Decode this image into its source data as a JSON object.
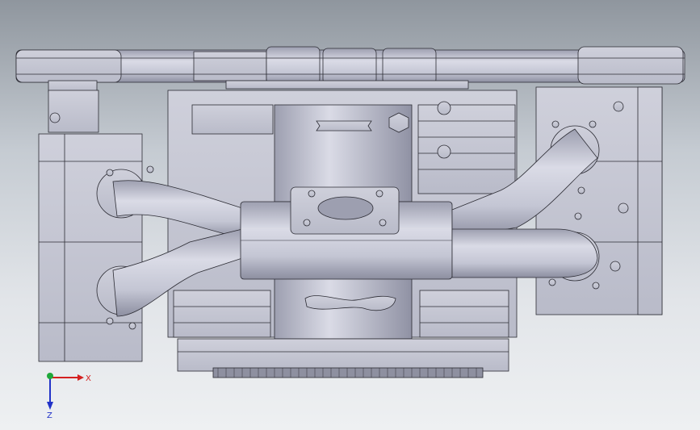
{
  "view": {
    "background_top": "#8f969e",
    "background_bottom": "#eef0f2",
    "model_fill": "#c9cad6",
    "model_shade": "#a7a9b8",
    "edge_color": "#2c2c34"
  },
  "triad": {
    "x_label": "X",
    "z_label": "Z",
    "x_color": "#d42020",
    "y_color": "#1fa83a",
    "z_color": "#2233c8"
  }
}
